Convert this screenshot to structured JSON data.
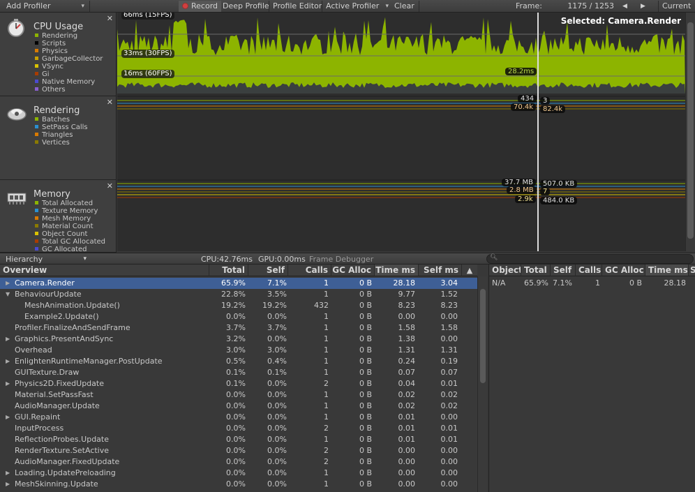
{
  "toolbar": {
    "add_profiler": "Add Profiler",
    "record": "Record",
    "deep_profile": "Deep Profile",
    "profile_editor": "Profile Editor",
    "active_profiler": "Active Profiler",
    "clear": "Clear",
    "frame_label": "Frame:",
    "frame_value": "1175 / 1253",
    "current": "Current"
  },
  "modules": {
    "cpu": {
      "title": "CPU Usage",
      "legend": [
        {
          "label": "Rendering",
          "color": "#8db400"
        },
        {
          "label": "Scripts",
          "color": "#000000"
        },
        {
          "label": "Physics",
          "color": "#d87a00"
        },
        {
          "label": "GarbageCollector",
          "color": "#c8a000"
        },
        {
          "label": "VSync",
          "color": "#d9c200"
        },
        {
          "label": "Gi",
          "color": "#a83c00"
        },
        {
          "label": "Native Memory",
          "color": "#4a4ad0"
        },
        {
          "label": "Others",
          "color": "#8a5fd0"
        }
      ],
      "labels": {
        "l66": "66ms (15FPS)",
        "l33": "33ms (30FPS)",
        "l16": "16ms (60FPS)",
        "cursor_value": "28.2ms"
      },
      "selected": "Selected: Camera.Render"
    },
    "rendering": {
      "title": "Rendering",
      "legend": [
        {
          "label": "Batches",
          "color": "#8db400"
        },
        {
          "label": "SetPass Calls",
          "color": "#2a8fd0"
        },
        {
          "label": "Triangles",
          "color": "#d87a00"
        },
        {
          "label": "Vertices",
          "color": "#8a7a00"
        }
      ],
      "values": {
        "batches_left": "434",
        "setpass_right": "3",
        "tris_left": "70.4k",
        "verts_right": "82.4k"
      }
    },
    "memory": {
      "title": "Memory",
      "legend": [
        {
          "label": "Total Allocated",
          "color": "#8db400"
        },
        {
          "label": "Texture Memory",
          "color": "#2a8fd0"
        },
        {
          "label": "Mesh Memory",
          "color": "#d87a00"
        },
        {
          "label": "Material Count",
          "color": "#8a7a00"
        },
        {
          "label": "Object Count",
          "color": "#d9c200"
        },
        {
          "label": "Total GC Allocated",
          "color": "#a83c00"
        },
        {
          "label": "GC Allocated",
          "color": "#4a4ad0"
        }
      ],
      "values": {
        "total_left": "37.7 MB",
        "texture_right": "507.0 KB",
        "mesh_left": "2.8 MB",
        "material_right": "7",
        "object_left": "2.9k",
        "gc_right": "484.0 KB"
      }
    }
  },
  "bottom_bar": {
    "view": "Hierarchy",
    "cpu": "CPU:42.76ms",
    "gpu": "GPU:0.00ms",
    "frame_debugger": "Frame Debugger"
  },
  "tree": {
    "headers": {
      "overview": "Overview",
      "total": "Total",
      "self": "Self",
      "calls": "Calls",
      "gc": "GC Alloc",
      "time": "Time ms",
      "selfms": "Self ms",
      "sort_arrow": "▲"
    },
    "rows": [
      {
        "name": "Camera.Render",
        "indent": 0,
        "expand": "right",
        "total": "65.9%",
        "self": "7.1%",
        "calls": "1",
        "gc": "0 B",
        "time": "28.18",
        "selfms": "3.04",
        "selected": true
      },
      {
        "name": "BehaviourUpdate",
        "indent": 0,
        "expand": "down",
        "total": "22.8%",
        "self": "3.5%",
        "calls": "1",
        "gc": "0 B",
        "time": "9.77",
        "selfms": "1.52"
      },
      {
        "name": "MeshAnimation.Update()",
        "indent": 1,
        "expand": "",
        "total": "19.2%",
        "self": "19.2%",
        "calls": "432",
        "gc": "0 B",
        "time": "8.23",
        "selfms": "8.23"
      },
      {
        "name": "Example2.Update()",
        "indent": 1,
        "expand": "",
        "total": "0.0%",
        "self": "0.0%",
        "calls": "1",
        "gc": "0 B",
        "time": "0.00",
        "selfms": "0.00"
      },
      {
        "name": "Profiler.FinalizeAndSendFrame",
        "indent": 0,
        "expand": "",
        "total": "3.7%",
        "self": "3.7%",
        "calls": "1",
        "gc": "0 B",
        "time": "1.58",
        "selfms": "1.58"
      },
      {
        "name": "Graphics.PresentAndSync",
        "indent": 0,
        "expand": "right",
        "total": "3.2%",
        "self": "0.0%",
        "calls": "1",
        "gc": "0 B",
        "time": "1.38",
        "selfms": "0.00"
      },
      {
        "name": "Overhead",
        "indent": 0,
        "expand": "",
        "total": "3.0%",
        "self": "3.0%",
        "calls": "1",
        "gc": "0 B",
        "time": "1.31",
        "selfms": "1.31"
      },
      {
        "name": "EnlightenRuntimeManager.PostUpdate",
        "indent": 0,
        "expand": "right",
        "total": "0.5%",
        "self": "0.4%",
        "calls": "1",
        "gc": "0 B",
        "time": "0.24",
        "selfms": "0.19"
      },
      {
        "name": "GUITexture.Draw",
        "indent": 0,
        "expand": "",
        "total": "0.1%",
        "self": "0.1%",
        "calls": "1",
        "gc": "0 B",
        "time": "0.07",
        "selfms": "0.07"
      },
      {
        "name": "Physics2D.FixedUpdate",
        "indent": 0,
        "expand": "right",
        "total": "0.1%",
        "self": "0.0%",
        "calls": "2",
        "gc": "0 B",
        "time": "0.04",
        "selfms": "0.01"
      },
      {
        "name": "Material.SetPassFast",
        "indent": 0,
        "expand": "",
        "total": "0.0%",
        "self": "0.0%",
        "calls": "1",
        "gc": "0 B",
        "time": "0.02",
        "selfms": "0.02"
      },
      {
        "name": "AudioManager.Update",
        "indent": 0,
        "expand": "",
        "total": "0.0%",
        "self": "0.0%",
        "calls": "1",
        "gc": "0 B",
        "time": "0.02",
        "selfms": "0.02"
      },
      {
        "name": "GUI.Repaint",
        "indent": 0,
        "expand": "right",
        "total": "0.0%",
        "self": "0.0%",
        "calls": "1",
        "gc": "0 B",
        "time": "0.01",
        "selfms": "0.00"
      },
      {
        "name": "InputProcess",
        "indent": 0,
        "expand": "",
        "total": "0.0%",
        "self": "0.0%",
        "calls": "2",
        "gc": "0 B",
        "time": "0.01",
        "selfms": "0.01"
      },
      {
        "name": "ReflectionProbes.Update",
        "indent": 0,
        "expand": "",
        "total": "0.0%",
        "self": "0.0%",
        "calls": "1",
        "gc": "0 B",
        "time": "0.01",
        "selfms": "0.01"
      },
      {
        "name": "RenderTexture.SetActive",
        "indent": 0,
        "expand": "",
        "total": "0.0%",
        "self": "0.0%",
        "calls": "2",
        "gc": "0 B",
        "time": "0.00",
        "selfms": "0.00"
      },
      {
        "name": "AudioManager.FixedUpdate",
        "indent": 0,
        "expand": "",
        "total": "0.0%",
        "self": "0.0%",
        "calls": "2",
        "gc": "0 B",
        "time": "0.00",
        "selfms": "0.00"
      },
      {
        "name": "Loading.UpdatePreloading",
        "indent": 0,
        "expand": "right",
        "total": "0.0%",
        "self": "0.0%",
        "calls": "1",
        "gc": "0 B",
        "time": "0.00",
        "selfms": "0.00"
      },
      {
        "name": "MeshSkinning.Update",
        "indent": 0,
        "expand": "right",
        "total": "0.0%",
        "self": "0.0%",
        "calls": "1",
        "gc": "0 B",
        "time": "0.00",
        "selfms": "0.00"
      }
    ]
  },
  "object_panel": {
    "headers": {
      "object": "Object",
      "total": "Total",
      "self": "Self",
      "calls": "Calls",
      "gc": "GC Alloc",
      "time": "Time ms",
      "s": "S"
    },
    "row": {
      "object": "N/A",
      "total": "65.9%",
      "self": "7.1%",
      "calls": "1",
      "gc": "0 B",
      "time": "28.18"
    }
  },
  "colors": {
    "accent_green": "#8db400",
    "selection": "#3e5f96",
    "background": "#383838"
  }
}
